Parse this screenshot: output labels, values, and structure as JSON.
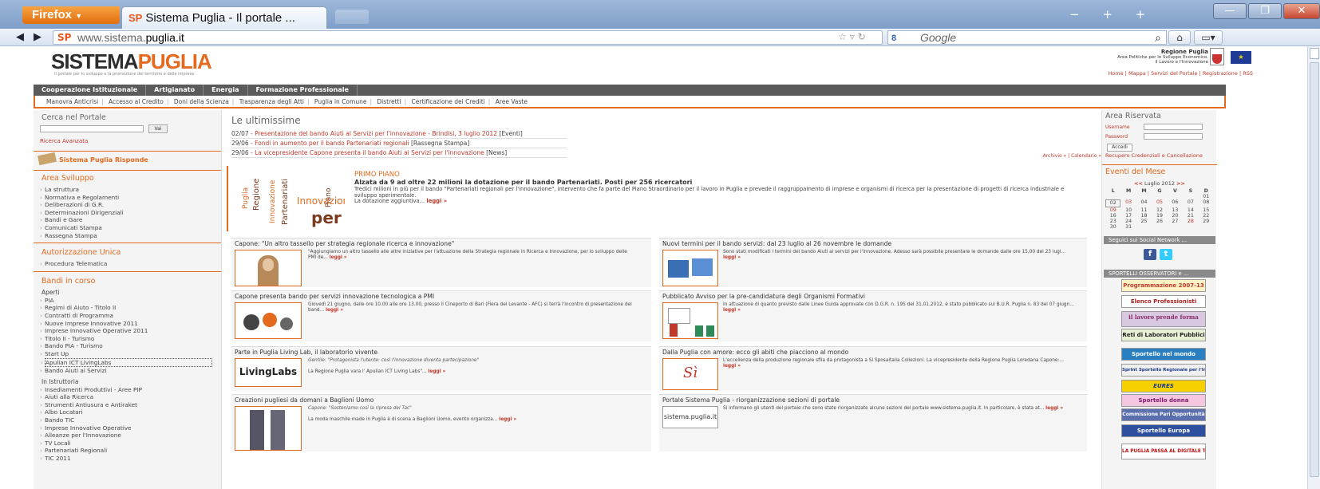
{
  "browser": {
    "app_button": "Firefox",
    "tab_title": "Sistema Puglia - Il portale ...",
    "tab_favicon": "SP",
    "url_prefix": "www.sistema.",
    "url_domain": "puglia.it",
    "search_placeholder": "Google",
    "search_engine_icon": "google-icon"
  },
  "site": {
    "logo_a": "SISTEMA",
    "logo_b": "PUGLIA",
    "tagline": "Il portale per lo sviluppo e la promozione del territorio e delle imprese",
    "regione_title": "Regione Puglia",
    "regione_line1": "Area Politiche per lo Sviluppo Economico,",
    "regione_line2": "il Lavoro e l'Innovazione",
    "eu_flag": "eu-flag-icon",
    "toplinks": [
      "Home",
      "Mappa",
      "Servizi del Portale",
      "Registrazione",
      "RSS"
    ]
  },
  "menu1": [
    "Cooperazione Istituzionale",
    "Artigianato",
    "Energia",
    "Formazione Professionale"
  ],
  "menu2": [
    "Manovra Anticrisi",
    "Accesso al Credito",
    "Doni della Scienza",
    "Trasparenza degli Atti",
    "Puglia in Comune",
    "Distretti",
    "Certificazione dei Crediti",
    "Aree Vaste"
  ],
  "left": {
    "search_title": "Cerca nel Portale",
    "search_btn": "Vai",
    "advanced": "Ricerca Avanzata",
    "risponde": "Sistema Puglia Risponde",
    "area_title": "Area Sviluppo",
    "area_items": [
      "La struttura",
      "Normativa e Regolamenti",
      "Deliberazioni di G.R.",
      "Determinazioni Dirigenziali",
      "Bandi e Gare",
      "Comunicati Stampa",
      "Rassegna Stampa"
    ],
    "aut_title": "Autorizzazione Unica",
    "aut_items": [
      "Procedura Telematica"
    ],
    "bandi_title": "Bandi in corso",
    "aperti": "Aperti",
    "aperti_items": [
      "PIA",
      "Regimi di Aiuto - Titolo II",
      "Contratti di Programma",
      "Nuove Imprese Innovative 2011",
      "Imprese Innovative Operative 2011",
      "Titolo II - Turismo",
      "Bando PIA - Turismo",
      "Start Up",
      "Apulian ICT LivingLabs",
      "Bando Aiuti ai Servizi"
    ],
    "istruttoria": "In Istruttoria",
    "istr_items": [
      "Insediamenti Produttivi - Aree PIP",
      "Aiuti alla Ricerca",
      "Strumenti Antiusura e Antiraket",
      "Albo Locatari",
      "Bando TIC",
      "Imprese Innovative Operative",
      "Alleanze per l'Innovazione",
      "TV Locali",
      "Partenariati Regionali",
      "TIC 2011"
    ]
  },
  "ultimissime": {
    "title": "Le ultimissime",
    "items": [
      {
        "date": "02/07",
        "text": "Presentazione del bando Aiuti ai Servizi per l'innovazione - Brindisi, 3 luglio 2012",
        "tag": "[Eventi]"
      },
      {
        "date": "29/06",
        "text": "Fondi in aumento per il bando Partenariati regionali",
        "tag": "[Rassegna Stampa]"
      },
      {
        "date": "29/06",
        "text": "La vicepresidente Capone presenta il bando Aiuti ai Servizi per l'innovazione",
        "tag": "[News]"
      }
    ],
    "archivio": "Archivio »  |  Calendario »"
  },
  "primo": {
    "label": "PRIMO PIANO",
    "headline": "Alzata da 9 ad oltre 22 milioni la dotazione per il bando Partenariati. Posti per 256 ricercatori",
    "body": "Tredici milioni in più per il bando \"Partenariati regionali per l'innovazione\", intervento che fa parte del Piano Straordinario per il lavoro in Puglia e prevede il raggruppamento di imprese e organismi di ricerca per la presentazione di progetti di ricerca industriale e sviluppo sperimentale.",
    "body2": "La dotazione aggiuntiva...",
    "leggi": "leggi »"
  },
  "cards": [
    {
      "title": "Capone: \"Un altro tassello per strategia regionale ricerca e innovazione\"",
      "text": "\"Aggiungiamo un altro tassello alle altre iniziative per l'attuazione della Strategia regionale in Ricerca e Innovazione, per lo sviluppo delle PMI de...",
      "leggi": "leggi »",
      "img": "portrait-photo"
    },
    {
      "title": "Nuovi termini per il bando servizi: dal 23 luglio al 26 novembre le domande",
      "text": "Sono stati modificati i termini del bando Aiuti ai servizi per l'innovazione. Adesso sarà possibile presentare le domande dalle ore 15,00 del 23 lugl...",
      "leggi": "leggi »",
      "img": "puzzle-icon"
    },
    {
      "title": "Capone presenta bando per servizi innovazione tecnologica a PMI",
      "text": "Giovedì 21 giugno, dalle ore 10.00 alle ore 13.00, presso il Cineporto di Bari (Fiera del Levante - AFC) si terrà l'incontro di presentazione del band...",
      "leggi": "leggi »",
      "img": "gears-icon"
    },
    {
      "title": "Pubblicato Avviso per la pre-candidatura degli Organismi Formativi",
      "text": "In attuazione di quanto previsto dalle Linee Guida approvate con D.G.R. n. 195 del 31.01.2012, è stato pubblicato sul B.U.R. Puglia n. 83 del 07 giugn...",
      "leggi": "leggi »",
      "img": "teacher-icon"
    },
    {
      "title": "Parte in Puglia Living Lab, il laboratorio vivente",
      "italic": "Gentile: \"Protagonista l'utente: così l'innovazione diventa partecipazione\"",
      "text": "La Regione Puglia vara l' Apulian ICT Living Labs\"...",
      "leggi": "leggi »",
      "img_text": "LivingLabs"
    },
    {
      "title": "Dalla Puglia con amore: ecco gli abiti che piacciono al mondo",
      "text": "L'eccellenza della produzione regionale sfila da protagonista a Si Sposaitalia Collezioni. La vicepresidente della Regione Puglia Loredana Capone:...",
      "leggi": "leggi »",
      "img_text": "Sì"
    },
    {
      "title": "Creazioni pugliesi da domani a Baglioni Uomo",
      "italic": "Capone: \"Sosteniamo così la ripresa del Tac\"",
      "text": "La moda maschile made in Puglia è di scena a Baglioni Uomo, evento organizza...",
      "leggi": "leggi »",
      "img": "fashion-photo"
    },
    {
      "title": "Portale Sistema Puglia - riorganizzazione sezioni di portale",
      "text": "Si informano gli utenti del portale che sono state riorganizzate alcune sezioni del portale www.sistema.puglia.it. In particolare, è stata at...",
      "leggi": "leggi »",
      "img_text": "sistema.puglia.it"
    }
  ],
  "right": {
    "area_title": "Area Riservata",
    "username": "Username",
    "password": "Password",
    "accedi": "Accedi",
    "recupero": "Recupero Credenziali e Cancellazione",
    "eventi": "Eventi del Mese",
    "month": "Luglio 2012",
    "prev": "<<",
    "next": ">>",
    "days": [
      "L",
      "M",
      "M",
      "G",
      "V",
      "S",
      "D"
    ],
    "cal": [
      "",
      "",
      "",
      "",
      "",
      "",
      "01",
      "02",
      "03",
      "04",
      "05",
      "06",
      "07",
      "08",
      "09",
      "10",
      "11",
      "12",
      "13",
      "14",
      "15",
      "16",
      "17",
      "18",
      "19",
      "20",
      "21",
      "22",
      "23",
      "24",
      "25",
      "26",
      "27",
      "28",
      "29",
      "30",
      "31",
      "",
      "",
      "",
      "",
      ""
    ],
    "social": "Seguici sui Social Network ...",
    "sportelli": "SPORTELLI OSSERVATORI e ...",
    "banners": [
      "Programmazione 2007-13",
      "Elenco Professionisti",
      "il lavoro prende forma",
      "Reti di Laboratori Pubblici",
      "Sportello nel mondo",
      "Sprint Sportello Regionale per l'Internazionalizzazione",
      "EURES",
      "Sportello donna",
      "Commissione Pari Opportunità",
      "Sportello Europa",
      "LA PUGLIA PASSA AL DIGITALE TERRESTRE"
    ]
  }
}
